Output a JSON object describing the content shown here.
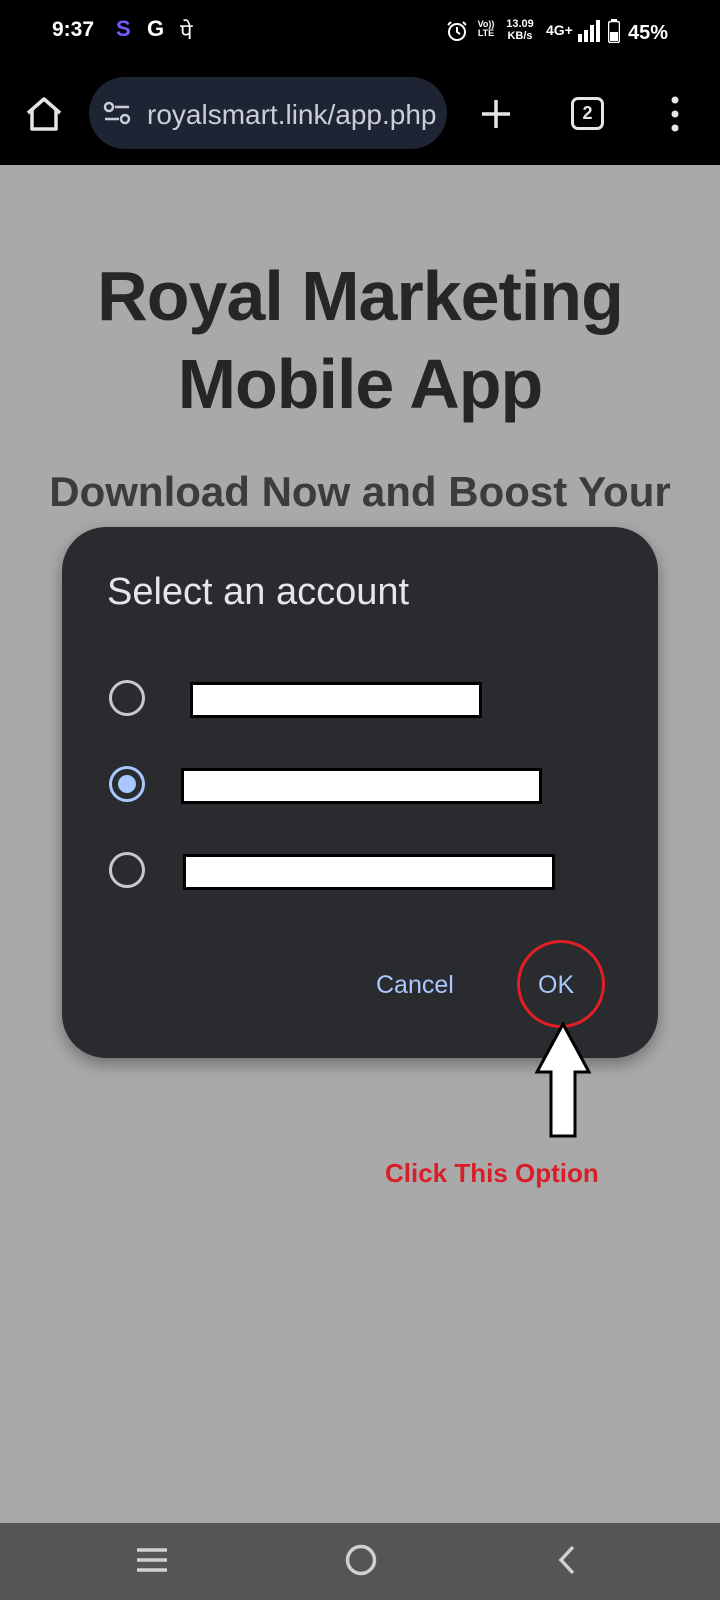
{
  "status_bar": {
    "time": "9:37",
    "app_icons": [
      "S",
      "G",
      "पे"
    ],
    "volte_top": "Vo))",
    "volte_bottom": "LTE",
    "speed_value": "13.09",
    "speed_unit": "KB/s",
    "network": "4G+",
    "battery": "45%"
  },
  "browser": {
    "url": "royalsmart.link/app.php",
    "tab_count": "2"
  },
  "page": {
    "title_line1": "Royal Marketing",
    "title_line2": "Mobile App",
    "subtitle": "Download Now and Boost Your"
  },
  "dialog": {
    "title": "Select an account",
    "accounts": [
      {
        "selected": false
      },
      {
        "selected": true
      },
      {
        "selected": false
      }
    ],
    "cancel_label": "Cancel",
    "ok_label": "OK"
  },
  "annotation": {
    "text": "Click This Option",
    "color": "#d81e28"
  }
}
